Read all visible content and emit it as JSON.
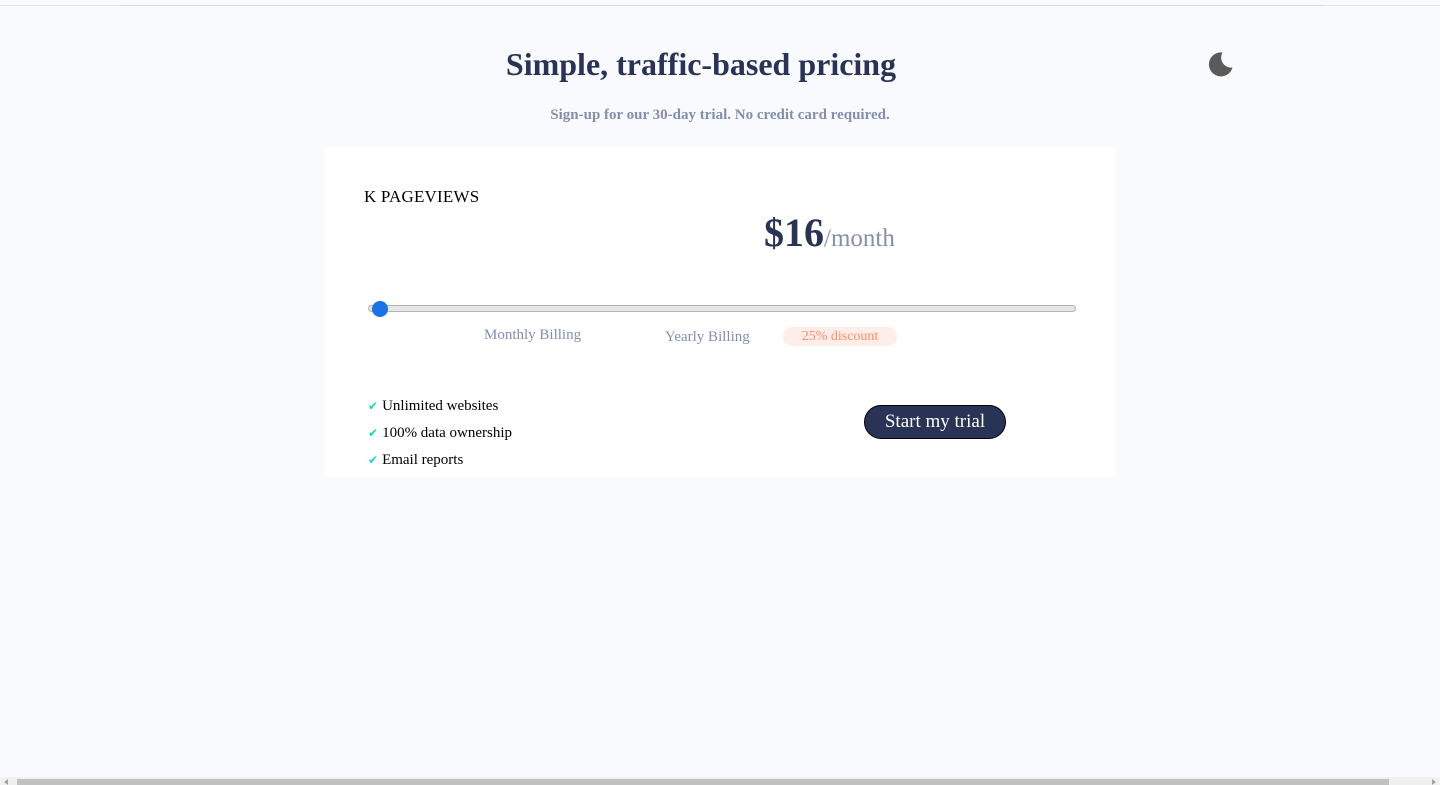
{
  "header": {
    "title": "Simple, traffic-based pricing",
    "subtitle": "Sign-up for our 30-day trial. No credit card required."
  },
  "theme_toggle": {
    "icon": "moon-icon",
    "color": "#5a5a5a"
  },
  "card": {
    "pageviews_label": "K PAGEVIEWS",
    "price": {
      "amount": "$16",
      "period": "/month"
    },
    "slider": {
      "value_fraction": 0.0
    },
    "billing": {
      "monthly_label": "Monthly Billing",
      "yearly_label": "Yearly Billing",
      "discount_label": "25% discount"
    },
    "features": [
      {
        "check": "✔",
        "label": "Unlimited websites"
      },
      {
        "check": "✔",
        "label": "100% data ownership"
      },
      {
        "check": "✔",
        "label": "Email reports"
      }
    ],
    "cta_label": "Start my trial"
  },
  "colors": {
    "background": "#f9fafe",
    "heading": "#293356",
    "muted": "#848ead",
    "slider_accent": "#1a73e8",
    "check": "#10d8c4",
    "discount_bg": "#feede8",
    "discount_text": "#ff8d68",
    "cta_bg": "#293356"
  }
}
